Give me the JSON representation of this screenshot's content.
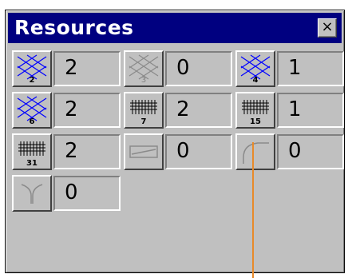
{
  "window": {
    "title": "Resources",
    "close_label": "×"
  },
  "resources": [
    {
      "icon": "lattice-icon",
      "tile_label": "2",
      "count": "2"
    },
    {
      "icon": "lattice-icon",
      "tile_label": "3",
      "count": "0",
      "disabled": true
    },
    {
      "icon": "lattice-icon",
      "tile_label": "4",
      "count": "1"
    },
    {
      "icon": "lattice-icon",
      "tile_label": "6",
      "count": "2"
    },
    {
      "icon": "plait-icon",
      "tile_label": "7",
      "count": "2"
    },
    {
      "icon": "plait-icon",
      "tile_label": "15",
      "count": "1"
    },
    {
      "icon": "plait-icon",
      "tile_label": "31",
      "count": "2"
    },
    {
      "icon": "merge-icon",
      "tile_label": "",
      "count": "0",
      "disabled": true
    },
    {
      "icon": "curve-icon",
      "tile_label": "",
      "count": "0",
      "disabled": true
    },
    {
      "icon": "split-icon",
      "tile_label": "",
      "count": "0",
      "disabled": true
    }
  ],
  "colors": {
    "titlebar": "#000080",
    "face": "#c0c0c0",
    "pointer": "#e88a2a"
  }
}
